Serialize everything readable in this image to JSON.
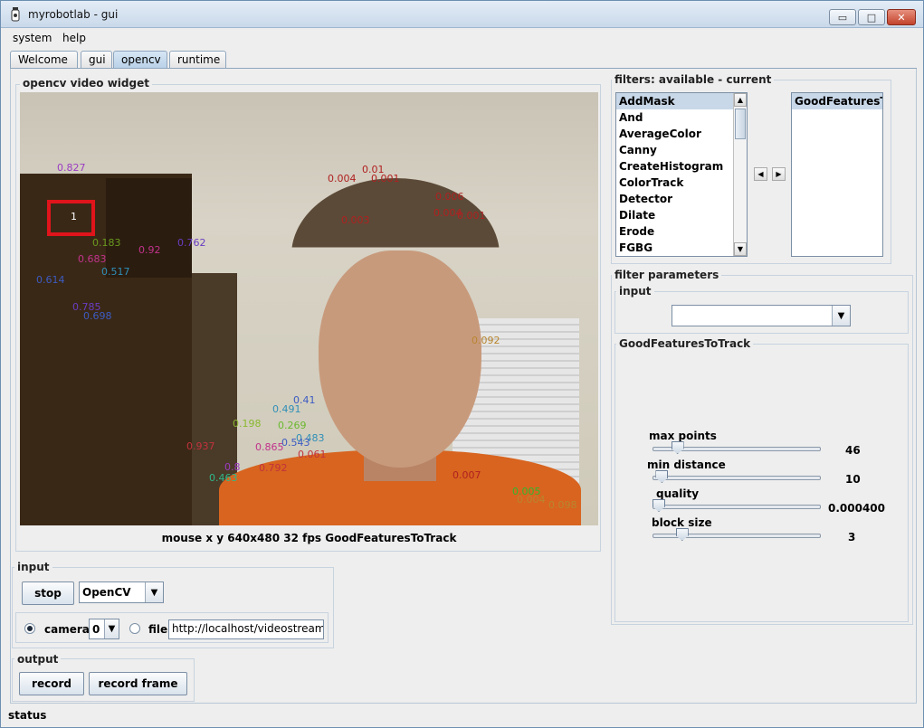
{
  "window": {
    "title": "myrobotlab - gui",
    "min_symbol": "▭",
    "max_symbol": "□",
    "close_symbol": "✕"
  },
  "menu": {
    "items": [
      "system",
      "help"
    ]
  },
  "tabs": [
    "Welcome",
    "gui",
    "opencv",
    "runtime"
  ],
  "video_widget": {
    "label": "opencv  video widget",
    "caption": "mouse x y  640x480  32 fps  GoodFeaturesToTrack",
    "tracked_label": "1",
    "feature_labels": [
      {
        "text": "0.827",
        "color": "#9b3cc2"
      },
      {
        "text": "0.004",
        "color": "#b02020"
      },
      {
        "text": "0.01",
        "color": "#b02020"
      },
      {
        "text": "0.001",
        "color": "#b02020"
      },
      {
        "text": "0.006",
        "color": "#b02020"
      },
      {
        "text": "0.004",
        "color": "#b02020"
      },
      {
        "text": "0.001",
        "color": "#b02020"
      },
      {
        "text": "0.003",
        "color": "#b02020"
      },
      {
        "text": "0.183",
        "color": "#6a9a1e"
      },
      {
        "text": "0.92",
        "color": "#c2328c"
      },
      {
        "text": "0.762",
        "color": "#6a3cc2"
      },
      {
        "text": "0.683",
        "color": "#c2328c"
      },
      {
        "text": "0.517",
        "color": "#2f8fb8"
      },
      {
        "text": "0.614",
        "color": "#3c5bc2"
      },
      {
        "text": "0.785",
        "color": "#6a3cc2"
      },
      {
        "text": "0.698",
        "color": "#3c5bc2"
      },
      {
        "text": "0.092",
        "color": "#b8862f"
      },
      {
        "text": "0.41",
        "color": "#3c5bc2"
      },
      {
        "text": "0.491",
        "color": "#2f8fb8"
      },
      {
        "text": "0.198",
        "color": "#8ab82f"
      },
      {
        "text": "0.269",
        "color": "#6ab82f"
      },
      {
        "text": "0.483",
        "color": "#2f8fb8"
      },
      {
        "text": "0.937",
        "color": "#c2323c"
      },
      {
        "text": "0.865",
        "color": "#c2328c"
      },
      {
        "text": "0.543",
        "color": "#3c5bc2"
      },
      {
        "text": "0.061",
        "color": "#c2323c"
      },
      {
        "text": "0.8",
        "color": "#9b3cc2"
      },
      {
        "text": "0.463",
        "color": "#2fb88a"
      },
      {
        "text": "0.792",
        "color": "#c2323c"
      },
      {
        "text": "0.007",
        "color": "#b02020"
      },
      {
        "text": "0.005",
        "color": "#2fb82f"
      },
      {
        "text": "0.004",
        "color": "#b8862f"
      },
      {
        "text": "0.098",
        "color": "#b8862f"
      }
    ]
  },
  "input_group": {
    "label": "input",
    "stop_label": "stop",
    "source_value": "OpenCV",
    "camera_label": "camera",
    "camera_index": "0",
    "file_label": "file",
    "file_url": "http://localhost/videostream.cgi"
  },
  "output_group": {
    "label": "output",
    "record_label": "record",
    "record_frame_label": "record frame"
  },
  "filters": {
    "label": "filters: available - current",
    "available": [
      "AddMask",
      "And",
      "AverageColor",
      "Canny",
      "CreateHistogram",
      "ColorTrack",
      "Detector",
      "Dilate",
      "Erode",
      "FGBG"
    ],
    "selected_available": "AddMask",
    "current": [
      "GoodFeaturesT..."
    ],
    "arrow_left": "◀",
    "arrow_right": "▶"
  },
  "filter_params": {
    "label": "filter parameters",
    "input_label": "input",
    "input_value": "",
    "section_label": "GoodFeaturesToTrack",
    "params": [
      {
        "name": "max points",
        "value": "46",
        "level": 0.12
      },
      {
        "name": "min distance",
        "value": "10",
        "level": 0.02
      },
      {
        "name": "quality",
        "value": "0.000400",
        "level": 0.0
      },
      {
        "name": "block size",
        "value": "3",
        "level": 0.15
      }
    ]
  },
  "status": {
    "text": "status"
  }
}
